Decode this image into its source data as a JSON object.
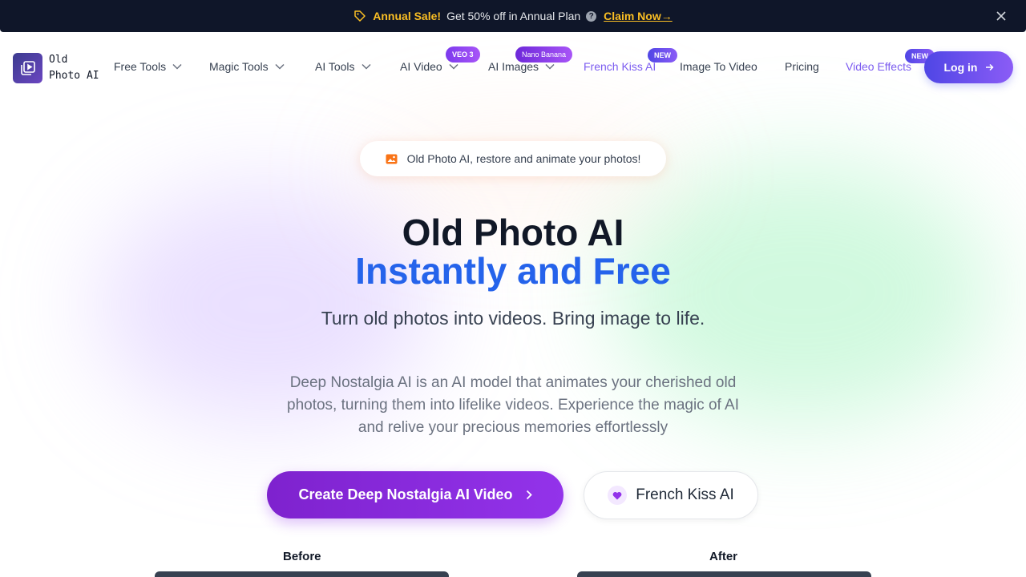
{
  "banner": {
    "icon": "tag-icon",
    "sale_label": "Annual Sale!",
    "offer_text": "Get 50% off in Annual Plan",
    "help_icon": "question-icon",
    "claim_label": "Claim Now→",
    "close_icon": "close-icon"
  },
  "logo": {
    "line1": "Old",
    "line2": "Photo AI",
    "icon": "play-stack-icon"
  },
  "nav": {
    "free_tools": "Free Tools",
    "magic_tools": "Magic Tools",
    "ai_tools": "AI Tools",
    "ai_video": "AI Video",
    "ai_video_badge": "VEO 3",
    "ai_images": "AI Images",
    "ai_images_badge": "Nano Banana",
    "french_kiss": "French Kiss AI",
    "french_kiss_badge": "NEW",
    "image_to_video": "Image To Video",
    "pricing": "Pricing",
    "video_effects": "Video Effects",
    "video_effects_badge": "NEW",
    "login_label": "Log in"
  },
  "hero": {
    "pill_text": "Old Photo AI, restore and animate your photos!",
    "title_line1": "Old Photo AI",
    "title_line2": "Instantly and Free",
    "subtitle": "Turn old photos into videos. Bring image to life.",
    "description": "Deep Nostalgia AI is an AI model that animates your cherished old photos, turning them into lifelike videos. Experience the magic of AI and relive your precious memories effortlessly",
    "cta_primary": "Create Deep Nostalgia AI Video",
    "cta_secondary": "French Kiss AI"
  },
  "compare": {
    "before_label": "Before",
    "after_label": "After"
  },
  "colors": {
    "banner_bg": "#0f1629",
    "accent_yellow": "#fbbf24",
    "title_blue": "#2563eb",
    "primary_purple": "#9333ea",
    "nav_purple": "#7c5cf0"
  }
}
